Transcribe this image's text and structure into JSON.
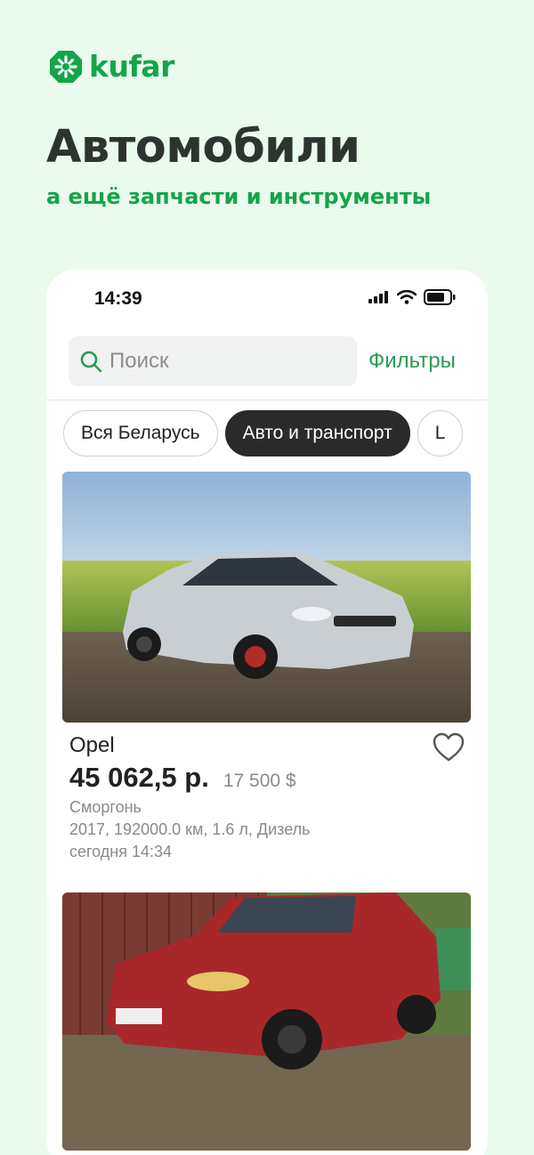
{
  "brand": {
    "name": "kufar",
    "color": "#13a54a"
  },
  "promo": {
    "headline": "Автомобили",
    "subheadline": "а ещё запчасти и инструменты"
  },
  "status_bar": {
    "time": "14:39"
  },
  "search": {
    "placeholder": "Поиск",
    "filters_label": "Фильтры"
  },
  "chips": [
    {
      "label": "Вся Беларусь",
      "active": false
    },
    {
      "label": "Авто и транспорт",
      "active": true
    },
    {
      "label": "L",
      "active": false
    }
  ],
  "listings": [
    {
      "title": "Opel",
      "price": "45 062,5 р.",
      "price_usd": "17 500 $",
      "city": "Сморгонь",
      "params": "2017, 192000.0 км, 1.6 л, Дизель",
      "date": "сегодня 14:34",
      "car_color": "#c9ced3"
    },
    {
      "car_color": "#a8282a"
    }
  ]
}
